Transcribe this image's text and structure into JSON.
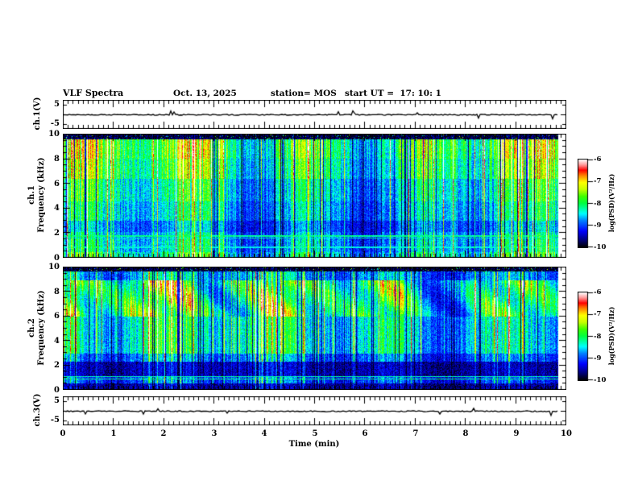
{
  "header": {
    "title": "VLF Spectra",
    "date": "Oct. 13, 2025",
    "station": "station= MOS",
    "start_ut": "start UT =  17: 10: 1"
  },
  "axes": {
    "time": {
      "label": "Time (min)",
      "min": 0,
      "max": 10,
      "ticks": [
        "0",
        "1",
        "2",
        "3",
        "4",
        "5",
        "6",
        "7",
        "8",
        "9",
        "10"
      ]
    },
    "freq_ticks": [
      "10",
      "8",
      "6",
      "4",
      "2",
      "0"
    ],
    "volt_ticks": [
      "5",
      "-5"
    ]
  },
  "panels": {
    "ch1_volt": {
      "ylabel": "ch.1(V)"
    },
    "ch1_spec": {
      "ylabel_line1": "ch.1",
      "ylabel_line2": "Frequency (kHz)"
    },
    "ch2_spec": {
      "ylabel_line1": "ch.2",
      "ylabel_line2": "Frequency (kHz)"
    },
    "ch3_volt": {
      "ylabel": "ch.3(V)"
    }
  },
  "colorbar": {
    "label": "log(PSD)(V²/Hz)",
    "ticks": [
      "-6",
      "-7",
      "-8",
      "-9",
      "-10"
    ],
    "zmin": -10,
    "zmax": -6,
    "colormap": [
      [
        0.0,
        "#000008"
      ],
      [
        0.08,
        "#000080"
      ],
      [
        0.18,
        "#0000ff"
      ],
      [
        0.3,
        "#0080ff"
      ],
      [
        0.38,
        "#00ffff"
      ],
      [
        0.5,
        "#00ff40"
      ],
      [
        0.58,
        "#40ff00"
      ],
      [
        0.66,
        "#c8ff00"
      ],
      [
        0.74,
        "#ffff00"
      ],
      [
        0.82,
        "#ff8000"
      ],
      [
        0.88,
        "#ff0000"
      ],
      [
        0.94,
        "#ff9898"
      ],
      [
        1.0,
        "#ffffff"
      ]
    ]
  },
  "chart_data": [
    {
      "type": "line",
      "name": "ch.1 voltage strip",
      "ylabel": "ch.1(V)",
      "xlim": [
        0,
        10
      ],
      "yticks": [
        5,
        -5
      ],
      "description": "flat waveform near 0 V with tiny spikes, trace ends near 9.84 min"
    },
    {
      "type": "heatmap",
      "name": "ch.1 spectrogram",
      "ylabel": "ch.1 Frequency (kHz)",
      "xlim": [
        0,
        10
      ],
      "ylim": [
        0,
        10
      ],
      "zlabel": "log(PSD)(V²/Hz)",
      "zlim": [
        -10,
        -6
      ],
      "legend_position": "right colorbar",
      "description": "dense vertical sferic streaks over 0-9.5 kHz, strongest green/yellow/red 6-9.5 kHz, scattered dark column gaps, persistent narrow horizontal lines near 1.6-1.8 kHz and 0.9 kHz, nearly black band above 9.5 kHz, data ends near 9.84 min"
    },
    {
      "type": "heatmap",
      "name": "ch.2 spectrogram",
      "ylabel": "ch.2 Frequency (kHz)",
      "xlim": [
        0,
        10
      ],
      "ylim": [
        0,
        10
      ],
      "zlabel": "log(PSD)(V²/Hz)",
      "zlim": [
        -10,
        -6
      ],
      "legend_position": "right colorbar",
      "description": "bright blobby green-yellow emission 6-9.3 kHz, moderate streaks 3-6 kHz, dark band 1-2.3 kHz, narrow horizontal lines near 0.9-1.1 kHz, black band above 9.6 kHz, data ends near 9.84 min"
    },
    {
      "type": "line",
      "name": "ch.3 voltage strip",
      "ylabel": "ch.3(V)",
      "xlim": [
        0,
        10
      ],
      "yticks": [
        5,
        -5
      ],
      "description": "flat waveform near 0 V with tiny spikes, trace ends near 9.84 min"
    }
  ]
}
